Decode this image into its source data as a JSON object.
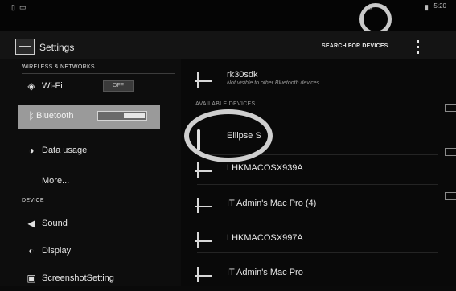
{
  "status_bar": {
    "icons": [
      "notification-icon",
      "image-icon"
    ],
    "right_icons": [
      "bluetooth-icon",
      "wifi-icon",
      "battery-icon"
    ],
    "time": "5:20"
  },
  "action_bar": {
    "title": "Settings",
    "search_devices": "SEARCH FOR DEVICES"
  },
  "left_panel": {
    "sections": [
      {
        "header": "WIRELESS & NETWORKS"
      },
      {
        "header": "DEVICE"
      }
    ],
    "items": [
      {
        "label": "Wi-Fi",
        "icon": "wifi-icon",
        "toggle": "OFF"
      },
      {
        "label": "Bluetooth",
        "icon": "bluetooth-icon",
        "toggle": "ON",
        "selected": true
      },
      {
        "label": "Data usage",
        "icon": "data-usage-icon"
      },
      {
        "label": "More..."
      },
      {
        "label": "Sound",
        "icon": "speaker-icon"
      },
      {
        "label": "Display",
        "icon": "display-icon"
      },
      {
        "label": "ScreenshotSetting",
        "icon": "camera-icon"
      }
    ]
  },
  "right_panel": {
    "paired_device": {
      "name": "rk30sdk",
      "subtitle": "Not visible to other Bluetooth devices"
    },
    "available_header": "AVAILABLE DEVICES",
    "devices": [
      {
        "name": "Ellipse S",
        "icon": "headset-icon"
      },
      {
        "name": "LHKMACOSX939A",
        "icon": "laptop-icon"
      },
      {
        "name": "IT Admin's Mac Pro (4)",
        "icon": "laptop-icon"
      },
      {
        "name": "LHKMACOSX997A",
        "icon": "laptop-icon"
      },
      {
        "name": "IT Admin's Mac Pro",
        "icon": "laptop-icon"
      }
    ]
  }
}
